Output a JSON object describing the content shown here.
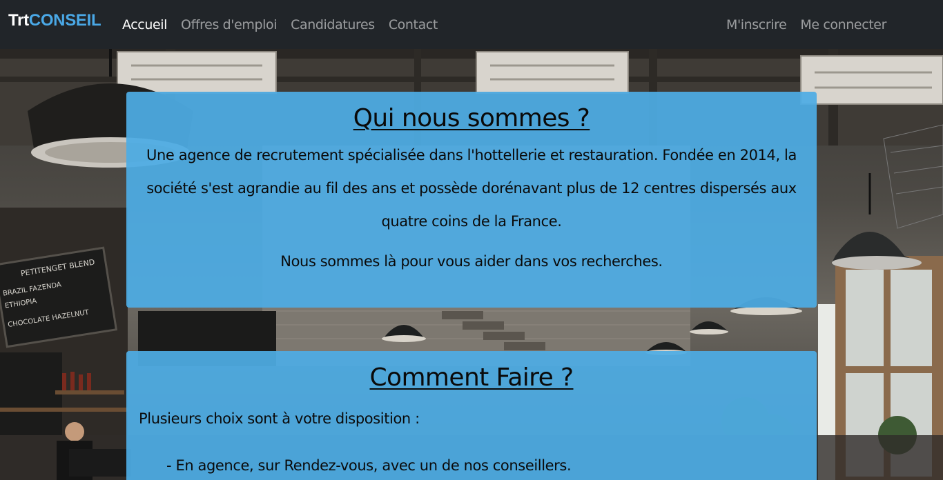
{
  "navbar": {
    "brand_part1": "Trt",
    "brand_part2": "CONSEIL",
    "left_links": [
      "Accueil",
      "Offres d'emploi",
      "Candidatures",
      "Contact"
    ],
    "right_links": [
      "M'inscrire",
      "Me connecter"
    ],
    "active_link": "Accueil"
  },
  "about": {
    "title": "Qui nous sommes ?",
    "text": "Une agence de recrutement spécialisée dans l'hottellerie et restauration. Fondée en 2014, la société s'est agrandie au fil des ans et possède dorénavant plus de 12 centres dispersés aux quatre coins de la France.",
    "text2": "Nous sommes là pour vous aider dans vos recherches."
  },
  "how": {
    "title": "Comment Faire ?",
    "intro": "Plusieurs choix sont à votre disposition :",
    "item1": "- En agence, sur Rendez-vous, avec un de nos conseillers."
  },
  "colors": {
    "navbar_bg": "#212529",
    "brand_accent": "#4aa8e6",
    "card_bg": "#4eace4"
  },
  "background": {
    "chalkboard_text": [
      "PETITENGET BLEND",
      "BRAZIL FAZENDA",
      "ETHIOPIA",
      "CHOCOLATE HAZELNUT"
    ]
  }
}
